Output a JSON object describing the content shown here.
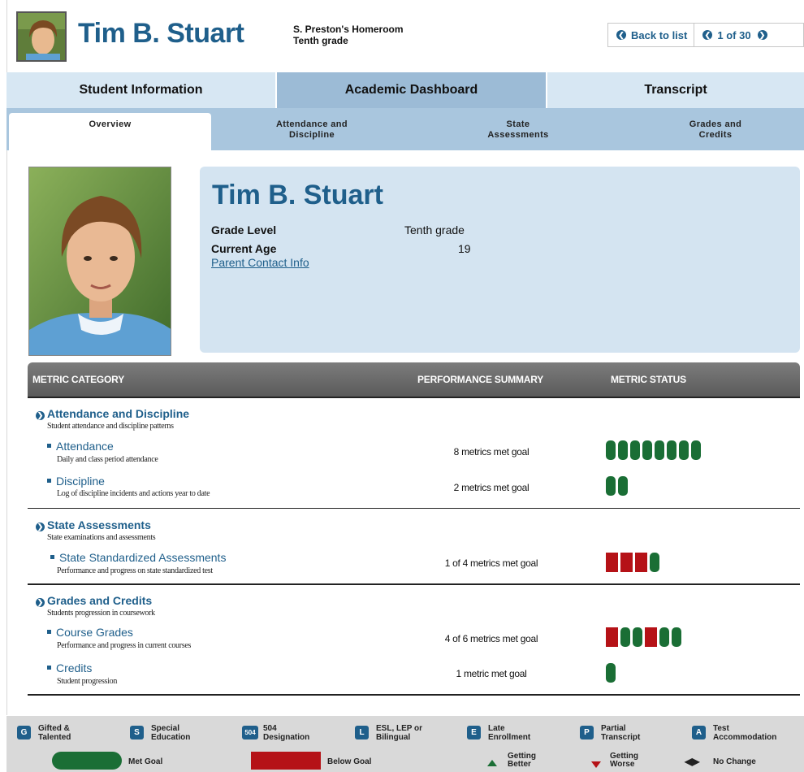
{
  "header": {
    "student_name": "Tim B. Stuart",
    "homeroom": "S. Preston's Homeroom",
    "grade": "Tenth grade",
    "back_label": "Back to list",
    "position": "1 of 30"
  },
  "main_tabs": [
    "Student Information",
    "Academic Dashboard",
    "Transcript"
  ],
  "sub_tabs": [
    {
      "line1": "Overview",
      "line2": ""
    },
    {
      "line1": "Attendance and",
      "line2": "Discipline"
    },
    {
      "line1": "State",
      "line2": "Assessments"
    },
    {
      "line1": "Grades and",
      "line2": "Credits"
    }
  ],
  "profile": {
    "name": "Tim B. Stuart",
    "grade_level_label": "Grade Level",
    "grade_level_value": "Tenth grade",
    "age_label": "Current Age",
    "age_value": "19",
    "contact_link": "Parent Contact Info"
  },
  "table": {
    "col_category": "METRIC CATEGORY",
    "col_summary": "PERFORMANCE SUMMARY",
    "col_status": "METRIC STATUS",
    "categories": [
      {
        "title": "Attendance and Discipline",
        "description": "Student attendance and discipline patterns",
        "metrics": [
          {
            "title": "Attendance",
            "description": "Daily and class period attendance",
            "summary": "8 metrics met goal"
          },
          {
            "title": "Discipline",
            "description": "Log of discipline incidents and actions year to date",
            "summary": "2 metrics met goal"
          }
        ]
      },
      {
        "title": "State Assessments",
        "description": "State examinations and assessments",
        "metrics": [
          {
            "title": "State Standardized Assessments",
            "description": "Performance and progress on state standardized test",
            "summary": "1 of 4 metrics met goal"
          }
        ]
      },
      {
        "title": "Grades and Credits",
        "description": "Students progression in coursework",
        "metrics": [
          {
            "title": "Course Grades",
            "description": "Performance and progress in current courses",
            "summary": "4 of 6 metrics met goal"
          },
          {
            "title": "Credits",
            "description": "Student progression",
            "summary": "1 metric met goal"
          }
        ]
      }
    ]
  },
  "legend": {
    "badges": [
      {
        "code": "G",
        "line1": "Gifted &",
        "line2": "Talented"
      },
      {
        "code": "S",
        "line1": "Special",
        "line2": "Education"
      },
      {
        "code": "504",
        "line1": "504",
        "line2": "Designation"
      },
      {
        "code": "L",
        "line1": "ESL, LEP or",
        "line2": "Bilingual"
      },
      {
        "code": "E",
        "line1": "Late",
        "line2": "Enrollment"
      },
      {
        "code": "P",
        "line1": "Partial",
        "line2": "Transcript"
      },
      {
        "code": "A",
        "line1": "Test",
        "line2": "Accommodation"
      }
    ],
    "met_goal": "Met Goal",
    "below_goal": "Below Goal",
    "getting_better_1": "Getting",
    "getting_better_2": "Better",
    "getting_worse_1": "Getting",
    "getting_worse_2": "Worse",
    "no_change": "No Change"
  },
  "colors": {
    "brand_blue": "#1f5f8b",
    "met_green": "#1a6e35",
    "below_red": "#b51217"
  }
}
